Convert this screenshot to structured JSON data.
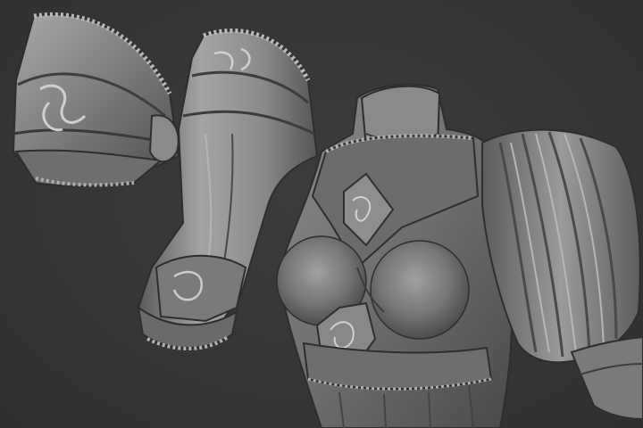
{
  "scene": {
    "background_color": "#363636",
    "material_color": "#8a8a8a",
    "objects": [
      {
        "name": "pauldron"
      },
      {
        "name": "vambrace"
      },
      {
        "name": "bodice"
      },
      {
        "name": "puffed-sleeve"
      }
    ]
  }
}
